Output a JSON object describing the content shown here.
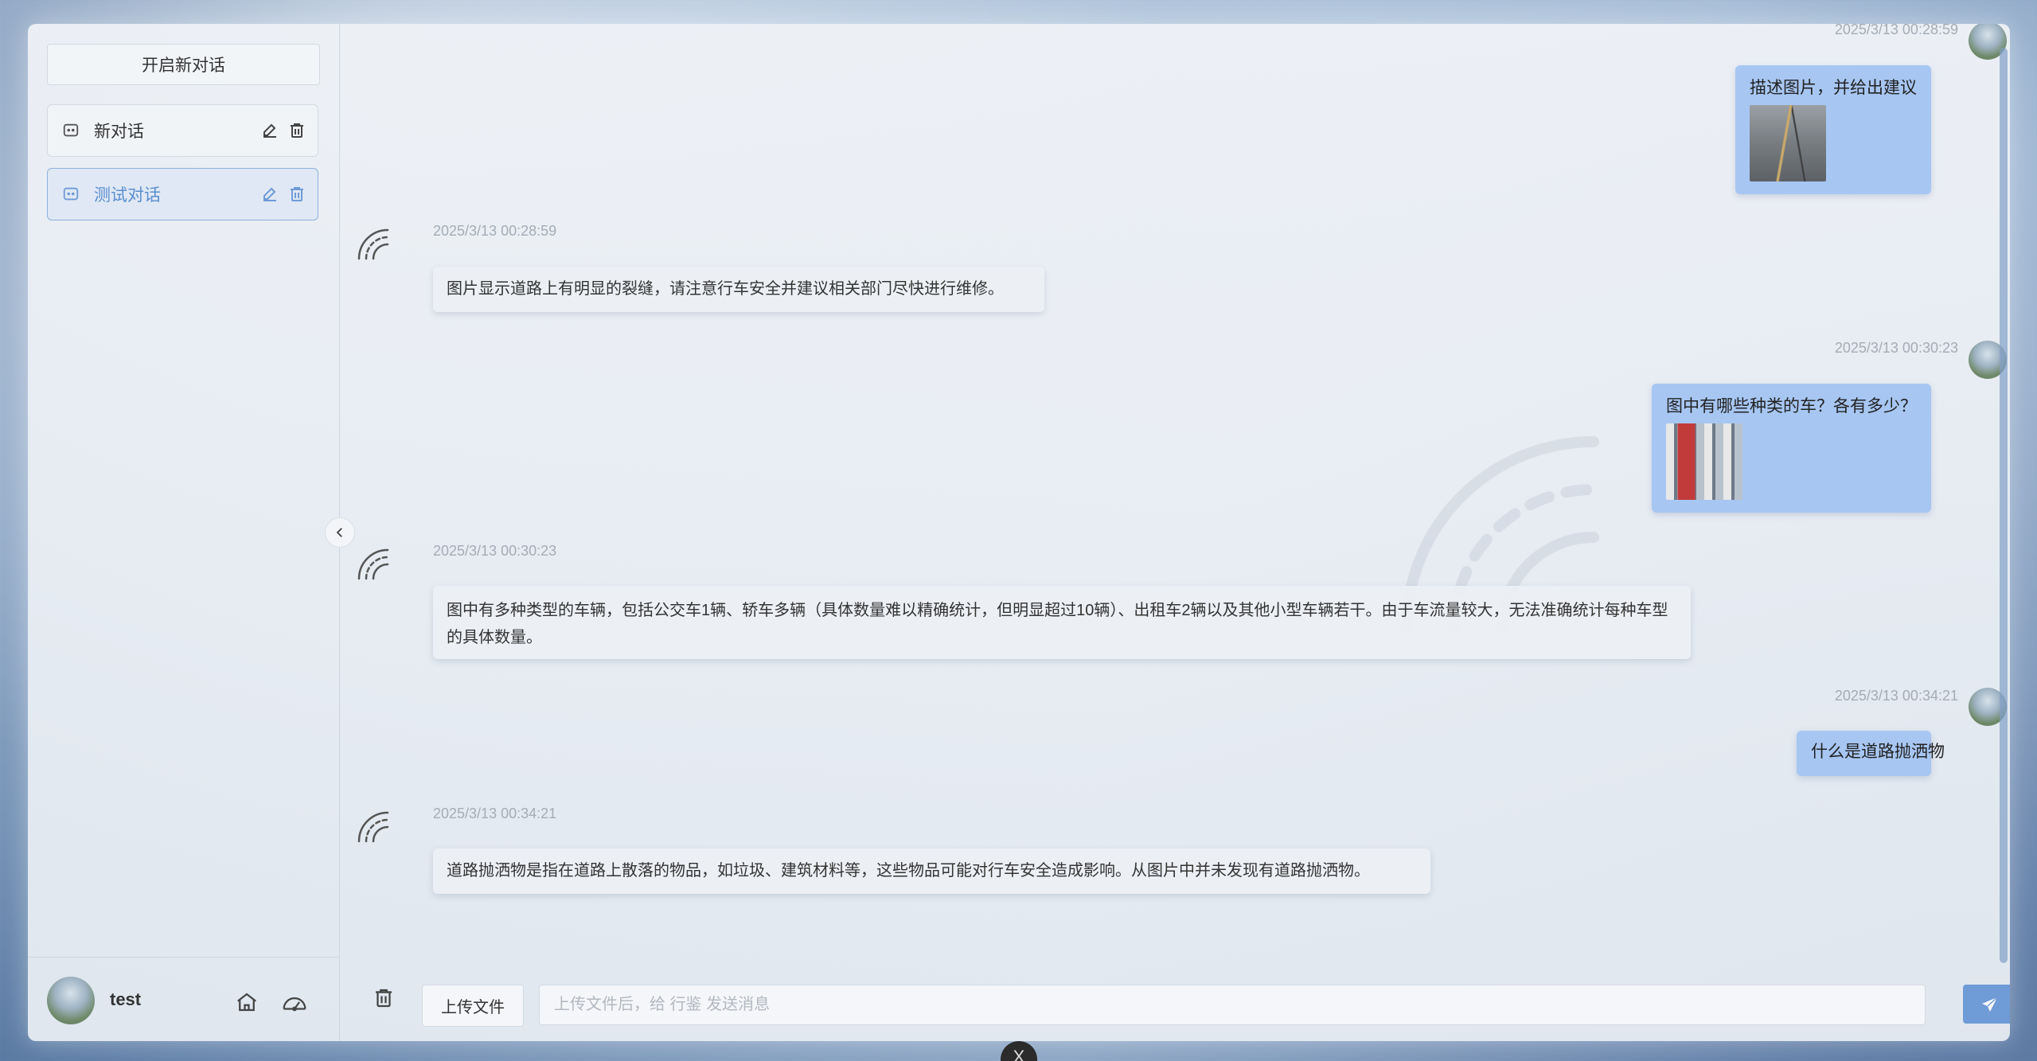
{
  "sidebar": {
    "new_chat_label": "开启新对话",
    "conversations": [
      {
        "label": "新对话",
        "active": false
      },
      {
        "label": "测试对话",
        "active": true
      }
    ],
    "footer": {
      "username": "test"
    }
  },
  "messages": [
    {
      "role": "user",
      "time": "2025/3/13 00:28:59",
      "text": "描述图片，并给出建议",
      "image": "road-crack-photo"
    },
    {
      "role": "assistant",
      "time": "2025/3/13 00:28:59",
      "text": "图片显示道路上有明显的裂缝，请注意行车安全并建议相关部门尽快进行维修。"
    },
    {
      "role": "user",
      "time": "2025/3/13 00:30:23",
      "text": "图中有哪些种类的车？各有多少？",
      "image": "traffic-photo"
    },
    {
      "role": "assistant",
      "time": "2025/3/13 00:30:23",
      "text": "图中有多种类型的车辆，包括公交车1辆、轿车多辆（具体数量难以精确统计，但明显超过10辆）、出租车2辆以及其他小型车辆若干。由于车流量较大，无法准确统计每种车型的具体数量。"
    },
    {
      "role": "user",
      "time": "2025/3/13 00:34:21",
      "text": "什么是道路抛洒物"
    },
    {
      "role": "assistant",
      "time": "2025/3/13 00:34:21",
      "text": "道路抛洒物是指在道路上散落的物品，如垃圾、建筑材料等，这些物品可能对行车安全造成影响。从图片中并未发现有道路抛洒物。"
    }
  ],
  "input_bar": {
    "upload_label": "上传文件",
    "placeholder": "上传文件后，给 行鉴 发送消息",
    "value": ""
  },
  "colors": {
    "accent": "#6f9bd6",
    "user_bubble": "#a7c6f2",
    "active_item_text": "#5b8ed0"
  },
  "icons": {
    "conversation": "chat-icon",
    "edit": "edit-icon",
    "delete": "trash-icon",
    "home": "home-icon",
    "dashboard": "gauge-icon",
    "collapse": "chevron-left-icon",
    "send": "send-icon",
    "bot": "road-logo-icon"
  }
}
